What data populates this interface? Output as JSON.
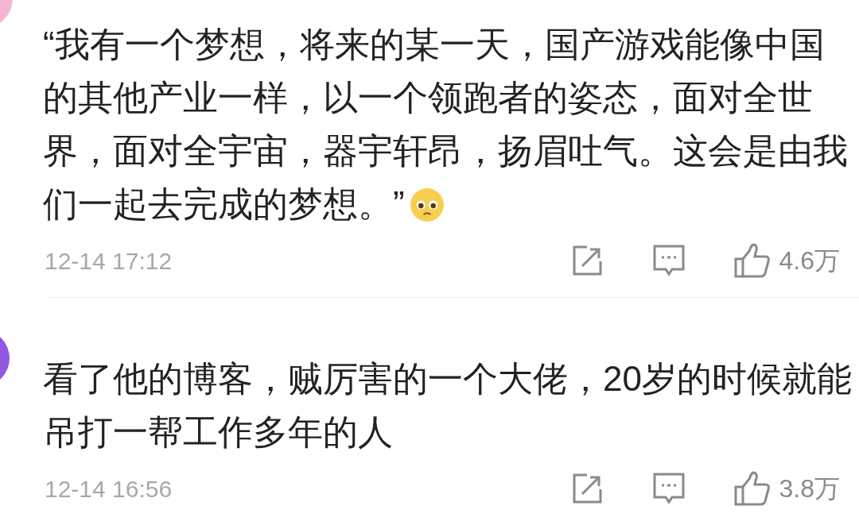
{
  "comments": [
    {
      "color": "#f4b6d2",
      "text": "“我有一个梦想，将来的某一天，国产游戏能像中国的其他产业一样，以一个领跑者的姿态，面对全世界，面对全宇宙，器宇轩昂，扬眉吐气。这会是由我们一起去完成的梦想。”",
      "trailing_emoji": true,
      "time": "12-14 17:12",
      "likes": "4.6万"
    },
    {
      "color": "#9157e0",
      "text": "看了他的博客，贼厉害的一个大佬，20岁的时候就能吊打一帮工作多年的人",
      "trailing_emoji": false,
      "time": "12-14 16:56",
      "likes": "3.8万"
    }
  ]
}
